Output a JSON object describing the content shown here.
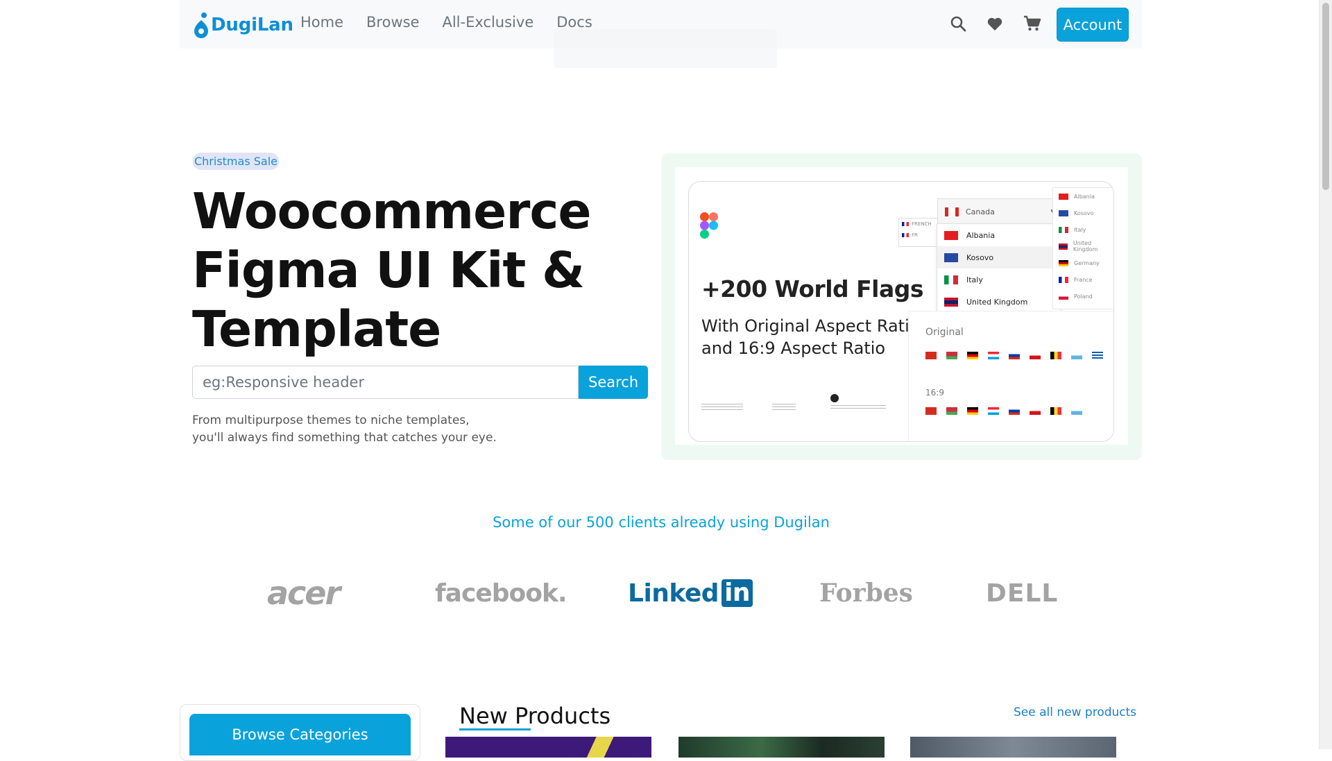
{
  "navbar": {
    "brand": "DugiLan",
    "links": [
      "Home",
      "Browse",
      "All-Exclusive",
      "Docs"
    ],
    "account_label": "Account"
  },
  "hero": {
    "badge": "Christmas Sale",
    "title_lines": [
      "Woocommerce",
      "Figma UI Kit &",
      "Template"
    ],
    "search_placeholder": "eg:Responsive header",
    "search_button": "Search",
    "description_lines": [
      "From multipurpose themes to niche templates,",
      "you'll always find something that catches your eye."
    ]
  },
  "promo": {
    "title": "+200 World Flags",
    "subtitle_lines": [
      "With Original Aspect Ratio",
      "and 16:9 Aspect Ratio"
    ],
    "dropdown_selected": "Canada",
    "dropdown_items": [
      "Albania",
      "Kosovo",
      "Italy",
      "United Kingdom"
    ],
    "side_items": [
      "Albania",
      "Kosovo",
      "Italy",
      "United Kingdom",
      "Germany",
      "France",
      "Poland"
    ],
    "lang_tags": [
      "FRENCH",
      "FR"
    ],
    "original_label": "Original",
    "ratio_label": "16:9"
  },
  "clients": {
    "heading": "Some of our 500 clients already using Dugilan",
    "logos": [
      "acer",
      "facebook.",
      "Linked",
      "in",
      "Forbes",
      "DELL"
    ]
  },
  "products": {
    "browse_categories": "Browse Categories",
    "section_title": "New Products",
    "see_all": "See all new products"
  },
  "colors": {
    "accent": "#0aa2da",
    "brand": "#0d8fd6",
    "linkedin": "#0b6aa0"
  }
}
